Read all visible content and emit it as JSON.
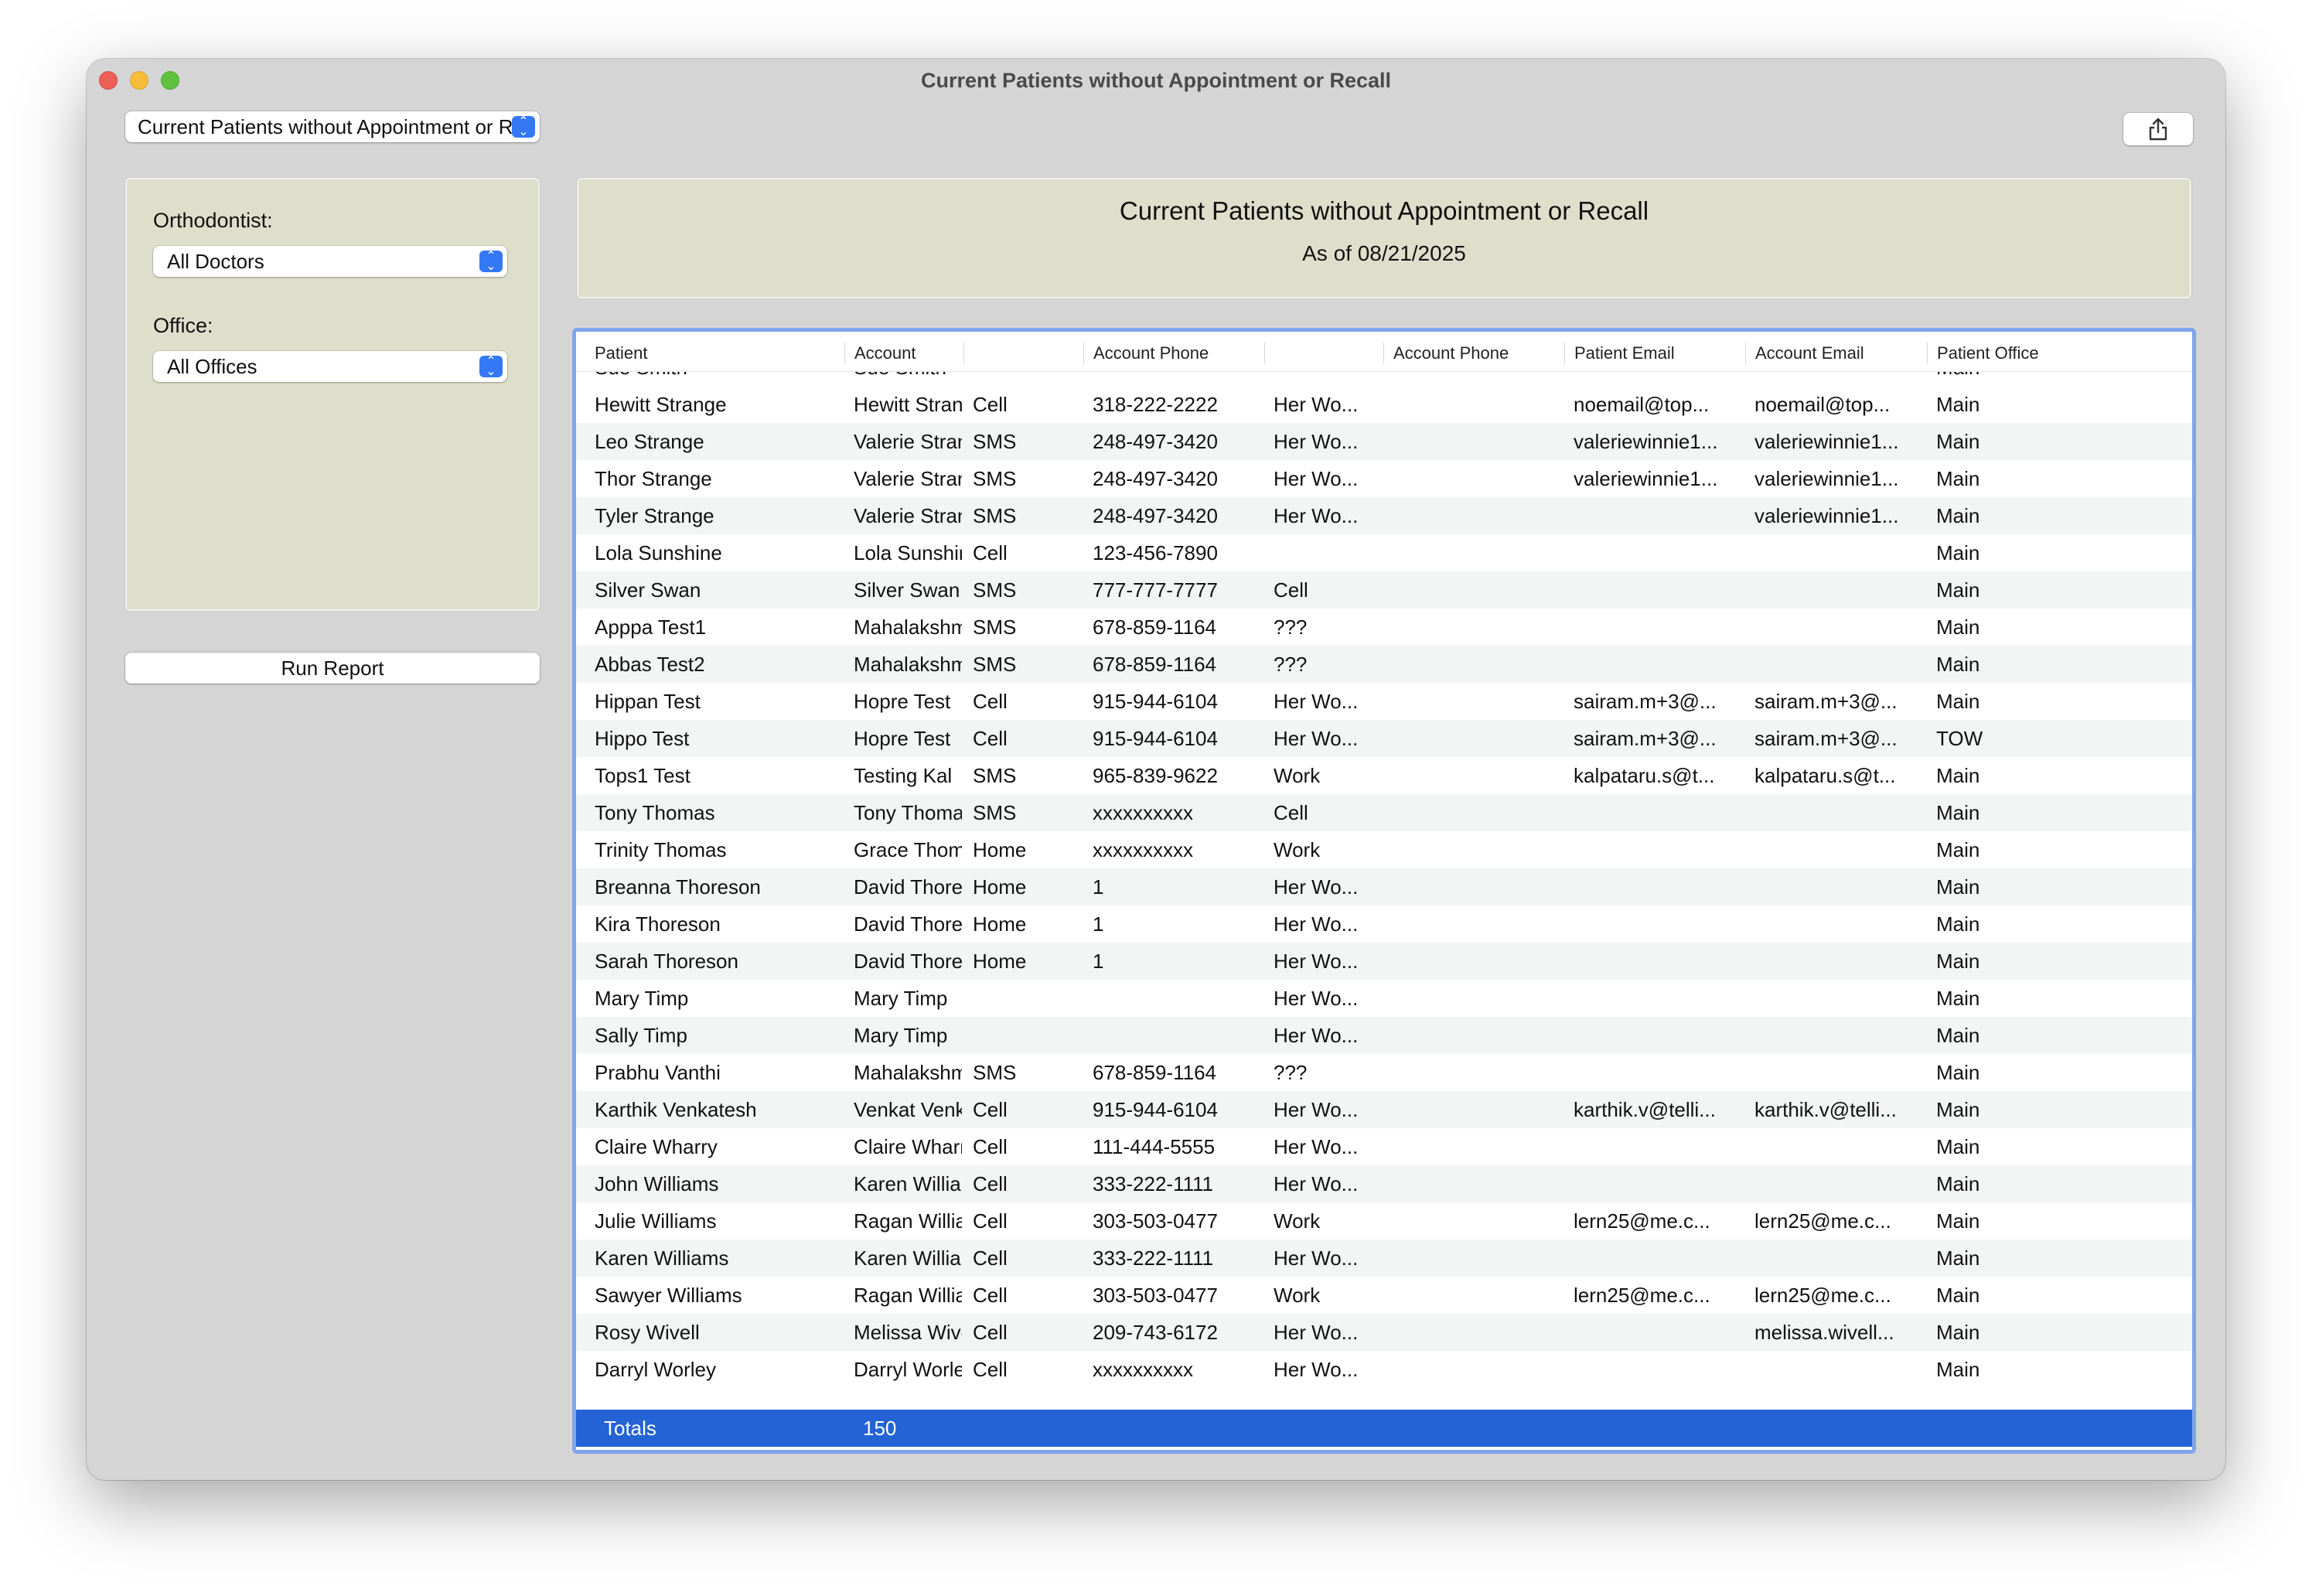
{
  "window": {
    "title": "Current Patients without Appointment or Recall"
  },
  "report_select": {
    "value": "Current Patients without Appointment or Recall"
  },
  "filters": {
    "orthodontist_label": "Orthodontist:",
    "orthodontist_value": "All Doctors",
    "office_label": "Office:",
    "office_value": "All Offices",
    "run_label": "Run Report"
  },
  "report": {
    "title": "Current Patients without Appointment or Recall",
    "date": "As of 08/21/2025"
  },
  "table": {
    "columns": [
      "Patient",
      "Account",
      "",
      "Account Phone",
      "",
      "Account Phone",
      "Patient Email",
      "Account Email",
      "Patient Office"
    ],
    "partial_row": [
      "Sue Smith",
      "Sue Smith",
      "",
      "",
      "",
      "",
      "",
      "",
      "Main"
    ],
    "rows": [
      [
        "Hewitt Strange",
        "Hewitt Strange",
        "Cell",
        "318-222-2222",
        "Her Wo...",
        "",
        "noemail@top...",
        "noemail@top...",
        "Main"
      ],
      [
        "Leo Strange",
        "Valerie Strange",
        "SMS",
        "248-497-3420",
        "Her Wo...",
        "",
        "valeriewinnie1...",
        "valeriewinnie1...",
        "Main"
      ],
      [
        "Thor Strange",
        "Valerie Strange",
        "SMS",
        "248-497-3420",
        "Her Wo...",
        "",
        "valeriewinnie1...",
        "valeriewinnie1...",
        "Main"
      ],
      [
        "Tyler Strange",
        "Valerie Strange",
        "SMS",
        "248-497-3420",
        "Her Wo...",
        "",
        "",
        "valeriewinnie1...",
        "Main"
      ],
      [
        "Lola Sunshine",
        "Lola Sunshine",
        "Cell",
        "123-456-7890",
        "",
        "",
        "",
        "",
        "Main"
      ],
      [
        "Silver Swan",
        "Silver Swan",
        "SMS",
        "777-777-7777",
        "Cell",
        "",
        "",
        "",
        "Main"
      ],
      [
        "Apppa Test1",
        "Mahalakshmi M",
        "SMS",
        "678-859-1164",
        "???",
        "",
        "",
        "",
        "Main"
      ],
      [
        "Abbas Test2",
        "Mahalakshmi M",
        "SMS",
        "678-859-1164",
        "???",
        "",
        "",
        "",
        "Main"
      ],
      [
        "Hippan Test",
        "Hopre Test",
        "Cell",
        "915-944-6104",
        "Her Wo...",
        "",
        "sairam.m+3@...",
        "sairam.m+3@...",
        "Main"
      ],
      [
        "Hippo Test",
        "Hopre Test",
        "Cell",
        "915-944-6104",
        "Her Wo...",
        "",
        "sairam.m+3@...",
        "sairam.m+3@...",
        "TOW"
      ],
      [
        "Tops1 Test",
        "Testing Kal",
        "SMS",
        "965-839-9622",
        "Work",
        "",
        "kalpataru.s@t...",
        "kalpataru.s@t...",
        "Main"
      ],
      [
        "Tony Thomas",
        "Tony Thomas",
        "SMS",
        "xxxxxxxxxx",
        "Cell",
        "",
        "",
        "",
        "Main"
      ],
      [
        "Trinity Thomas",
        "Grace Thomas",
        "Home",
        "xxxxxxxxxx",
        "Work",
        "",
        "",
        "",
        "Main"
      ],
      [
        "Breanna Thoreson",
        "David Thoreson",
        "Home",
        "1",
        "Her Wo...",
        "",
        "",
        "",
        "Main"
      ],
      [
        "Kira Thoreson",
        "David Thoreson",
        "Home",
        "1",
        "Her Wo...",
        "",
        "",
        "",
        "Main"
      ],
      [
        "Sarah Thoreson",
        "David Thoreson",
        "Home",
        "1",
        "Her Wo...",
        "",
        "",
        "",
        "Main"
      ],
      [
        "Mary Timp",
        "Mary Timp",
        "",
        "",
        "Her Wo...",
        "",
        "",
        "",
        "Main"
      ],
      [
        "Sally Timp",
        "Mary Timp",
        "",
        "",
        "Her Wo...",
        "",
        "",
        "",
        "Main"
      ],
      [
        "Prabhu Vanthi",
        "Mahalakshmi M",
        "SMS",
        "678-859-1164",
        "???",
        "",
        "",
        "",
        "Main"
      ],
      [
        "Karthik Venkatesh",
        "Venkat Venkatesh",
        "Cell",
        "915-944-6104",
        "Her Wo...",
        "",
        "karthik.v@telli...",
        "karthik.v@telli...",
        "Main"
      ],
      [
        "Claire Wharry",
        "Claire Wharry",
        "Cell",
        "111-444-5555",
        "Her Wo...",
        "",
        "",
        "",
        "Main"
      ],
      [
        "John Williams",
        "Karen Williams",
        "Cell",
        "333-222-1111",
        "Her Wo...",
        "",
        "",
        "",
        "Main"
      ],
      [
        "Julie Williams",
        "Ragan Williams",
        "Cell",
        "303-503-0477",
        "Work",
        "",
        "lern25@me.c...",
        "lern25@me.c...",
        "Main"
      ],
      [
        "Karen Williams",
        "Karen Williams",
        "Cell",
        "333-222-1111",
        "Her Wo...",
        "",
        "",
        "",
        "Main"
      ],
      [
        "Sawyer Williams",
        "Ragan Williams",
        "Cell",
        "303-503-0477",
        "Work",
        "",
        "lern25@me.c...",
        "lern25@me.c...",
        "Main"
      ],
      [
        "Rosy Wivell",
        "Melissa Wivell",
        "Cell",
        "209-743-6172",
        "Her Wo...",
        "",
        "",
        "melissa.wivell...",
        "Main"
      ],
      [
        "Darryl Worley",
        "Darryl Worley",
        "Cell",
        "xxxxxxxxxx",
        "Her Wo...",
        "",
        "",
        "",
        "Main"
      ]
    ],
    "totals": {
      "label": "Totals",
      "count": "150"
    }
  },
  "colors": {
    "panel_bg": "#dedfcb",
    "accent": "#3478f6",
    "selection": "#2463d6",
    "table_border": "#7fa4eb"
  },
  "icons": {
    "select_arrows": "updown-chevron-icon",
    "share": "share-icon"
  }
}
